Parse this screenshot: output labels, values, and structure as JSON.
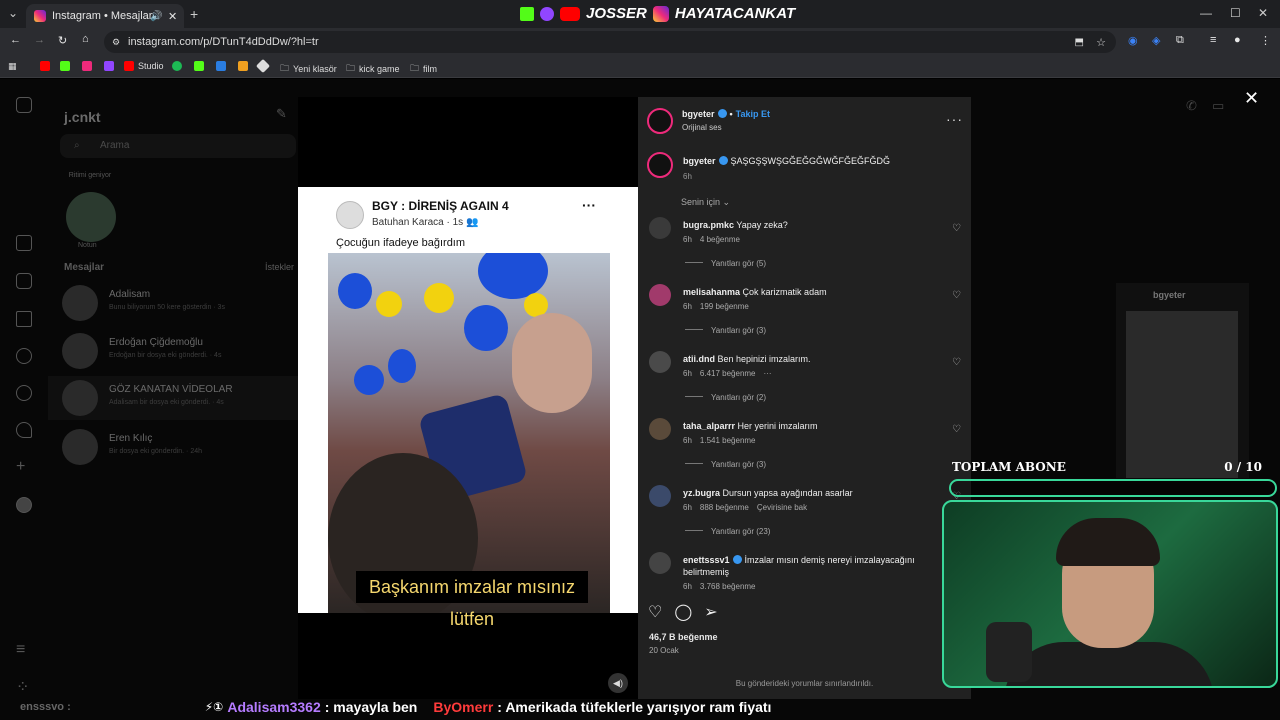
{
  "browser": {
    "tab_title": "Instagram • Mesajlar",
    "url": "instagram.com/p/DTunT4dDdDw/?hl=tr",
    "bookmarks": [
      "Studio",
      "Yeni klasör",
      "kick game",
      "film"
    ]
  },
  "stream_overlay": {
    "channel1": "JOSSER",
    "channel2": "HAYATACANKAT",
    "subs_label": "TOPLAM ABONE",
    "subs_count": "0 / 10",
    "subs_progress": 0
  },
  "dm": {
    "username": "j.cnkt",
    "search_placeholder": "Arama",
    "note_label": "Notun",
    "note_bubble": "Ritimi geniyor",
    "section": "Mesajlar",
    "requests": "İstekler",
    "rows": [
      {
        "name": "Adalisam",
        "sub": "Bunu biliyorum 50 kere gösterdin · 3s"
      },
      {
        "name": "Erdoğan Çiğdemoğlu",
        "sub": "Erdoğan bir dosya eki gönderdi. · 4s"
      },
      {
        "name": "GÖZ KANATAN VİDEOLAR",
        "sub": "Adalisam bir dosya eki gönderdi. · 4s"
      },
      {
        "name": "Eren Kılıç",
        "sub": "Bir dosya eki gönderdin. · 24h"
      }
    ]
  },
  "video": {
    "post_title": "BGY : DİRENİŞ AGAIN 4",
    "author": "Batuhan Karaca",
    "author_time": "1s",
    "caption": "Çocuğun ifadeye bağırdım",
    "subtitle": "Başkanım imzalar mısınız lütfen"
  },
  "post": {
    "username": "bgyeter",
    "follow": "Takip Et",
    "audio": "Orijinal ses",
    "caption_user": "bgyeter",
    "caption_text": "ŞAŞGŞŞWŞGĞEĞGĞWĞFĞEĞFĞDĞ",
    "caption_time": "6h",
    "sort_label": "Senin için",
    "likes": "46,7 B beğenme",
    "date": "20 Ocak",
    "limited_notice": "Bu gönderideki yorumlar sınırlandırıldı."
  },
  "comments": [
    {
      "user": "bugra.pmkc",
      "text": "Yapay zeka?",
      "time": "6h",
      "likes": "4 beğenme",
      "extra": "",
      "replies": "Yanıtları gör (5)"
    },
    {
      "user": "melisahanma",
      "text": "Çok karizmatik adam",
      "time": "6h",
      "likes": "199 beğenme",
      "extra": "",
      "replies": "Yanıtları gör (3)"
    },
    {
      "user": "atii.dnd",
      "text": "Ben hepinizi imzalarım.",
      "time": "6h",
      "likes": "6.417 beğenme",
      "extra": "···",
      "replies": "Yanıtları gör (2)"
    },
    {
      "user": "taha_alparrr",
      "text": "Her yerini imzalarım",
      "time": "6h",
      "likes": "1.541 beğenme",
      "extra": "",
      "replies": "Yanıtları gör (3)"
    },
    {
      "user": "yz.bugra",
      "text": "Dursun yapsa ayağından asarlar",
      "time": "6h",
      "likes": "888 beğenme",
      "extra": "Çevirisine bak",
      "replies": "Yanıtları gör (23)"
    },
    {
      "user": "enettsssv1",
      "text": "İmzalar mısın demiş nereyi imzalayacağını belirtmemiş",
      "time": "6h",
      "likes": "3.768 beğenme",
      "extra": "",
      "replies": ""
    }
  ],
  "background_post": {
    "username": "bgyeter"
  },
  "chat": {
    "faded_user": "ensssvo :",
    "user1": "Adalisam3362",
    "msg1": ": mayayla ben",
    "user2": "ByOmerr",
    "msg2": ": Amerikada tüfeklerle yarışıyor ram fiyatı"
  }
}
